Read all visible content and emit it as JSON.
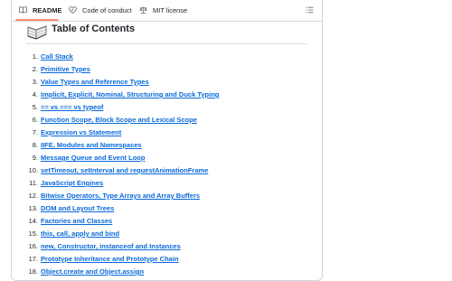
{
  "tabs": [
    {
      "label": "README",
      "icon": "book-icon",
      "active": true
    },
    {
      "label": "Code of conduct",
      "icon": "heart-handshake-icon",
      "active": false
    },
    {
      "label": "MIT license",
      "icon": "law-scale-icon",
      "active": false
    }
  ],
  "outline_icon": "list-outline-icon",
  "heading": "Table of Contents",
  "heading_icon": "open-book-icon",
  "colors": {
    "link": "#0969da",
    "tab_underline": "#fd8c73",
    "border": "#d0d7de"
  },
  "toc": [
    {
      "num": "1.",
      "label": "Call Stack"
    },
    {
      "num": "2.",
      "label": "Primitive Types"
    },
    {
      "num": "3.",
      "label": "Value Types and Reference Types"
    },
    {
      "num": "4.",
      "label": "Implicit, Explicit, Nominal, Structuring and Duck Typing"
    },
    {
      "num": "5.",
      "label": "== vs === vs typeof"
    },
    {
      "num": "6.",
      "label": "Function Scope, Block Scope and Lexical Scope"
    },
    {
      "num": "7.",
      "label": "Expression vs Statement"
    },
    {
      "num": "8.",
      "label": "IIFE, Modules and Namespaces"
    },
    {
      "num": "9.",
      "label": "Message Queue and Event Loop"
    },
    {
      "num": "10.",
      "label": "setTimeout, setInterval and requestAnimationFrame"
    },
    {
      "num": "11.",
      "label": "JavaScript Engines"
    },
    {
      "num": "12.",
      "label": "Bitwise Operators, Type Arrays and Array Buffers"
    },
    {
      "num": "13.",
      "label": "DOM and Layout Trees"
    },
    {
      "num": "14.",
      "label": "Factories and Classes"
    },
    {
      "num": "15.",
      "label": "this, call, apply and bind"
    },
    {
      "num": "16.",
      "label": "new, Constructor, instanceof and Instances"
    },
    {
      "num": "17.",
      "label": "Prototype Inheritance and Prototype Chain"
    },
    {
      "num": "18.",
      "label": "Object.create and Object.assign"
    }
  ]
}
